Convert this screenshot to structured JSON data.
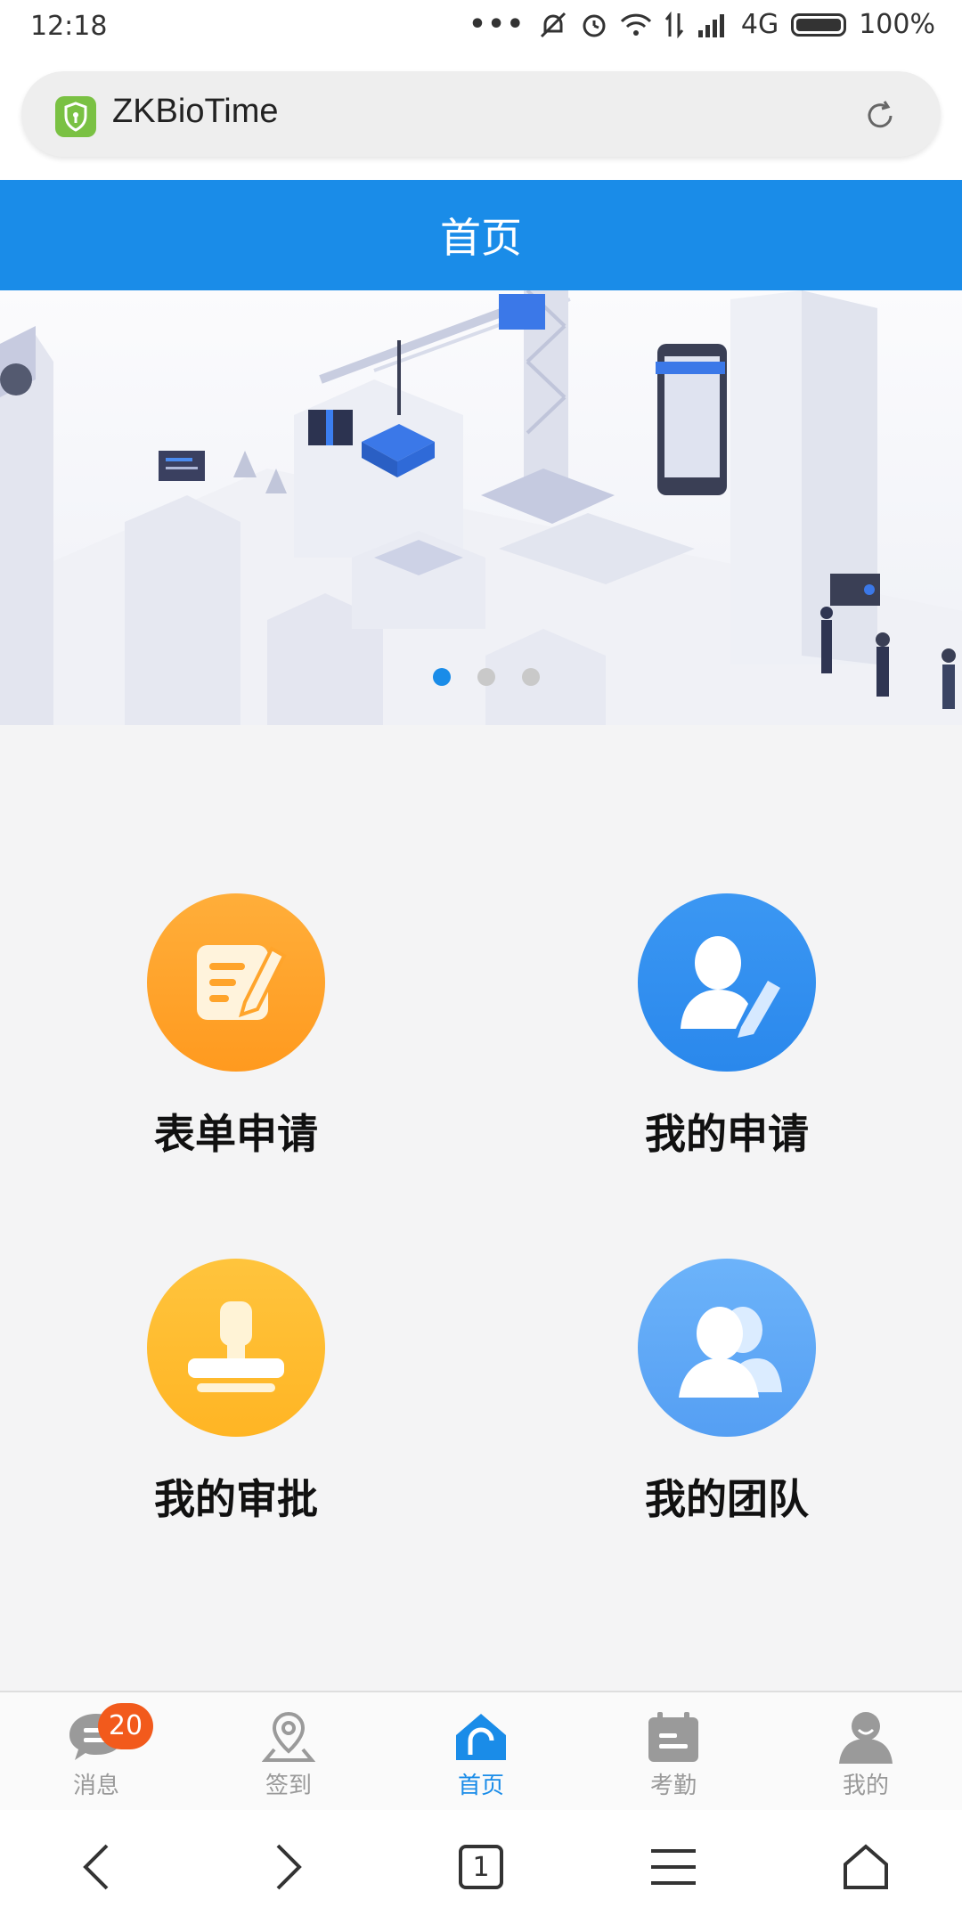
{
  "status_bar": {
    "time": "12:18",
    "network": "4G",
    "battery": "100%"
  },
  "browser": {
    "site_title": "ZKBioTime",
    "tab_count": "1"
  },
  "header": {
    "title": "首页"
  },
  "banner": {
    "slides": 3,
    "active_slide": 1
  },
  "menu": {
    "items": [
      {
        "label": "表单申请",
        "icon": "form-edit-icon",
        "color": "#ffa42b"
      },
      {
        "label": "我的申请",
        "icon": "user-edit-icon",
        "color": "#2e8ff0"
      },
      {
        "label": "我的审批",
        "icon": "stamp-icon",
        "color": "#ffbc2b"
      },
      {
        "label": "我的团队",
        "icon": "team-icon",
        "color": "#5aa8f7"
      }
    ]
  },
  "tabbar": {
    "items": [
      {
        "label": "消息",
        "icon": "message-icon",
        "badge": "20"
      },
      {
        "label": "签到",
        "icon": "location-pin-icon"
      },
      {
        "label": "首页",
        "icon": "home-icon",
        "active": true
      },
      {
        "label": "考勤",
        "icon": "calendar-icon"
      },
      {
        "label": "我的",
        "icon": "person-icon"
      }
    ]
  },
  "colors": {
    "primary": "#1a8ce8",
    "badge": "#f25a1c"
  }
}
